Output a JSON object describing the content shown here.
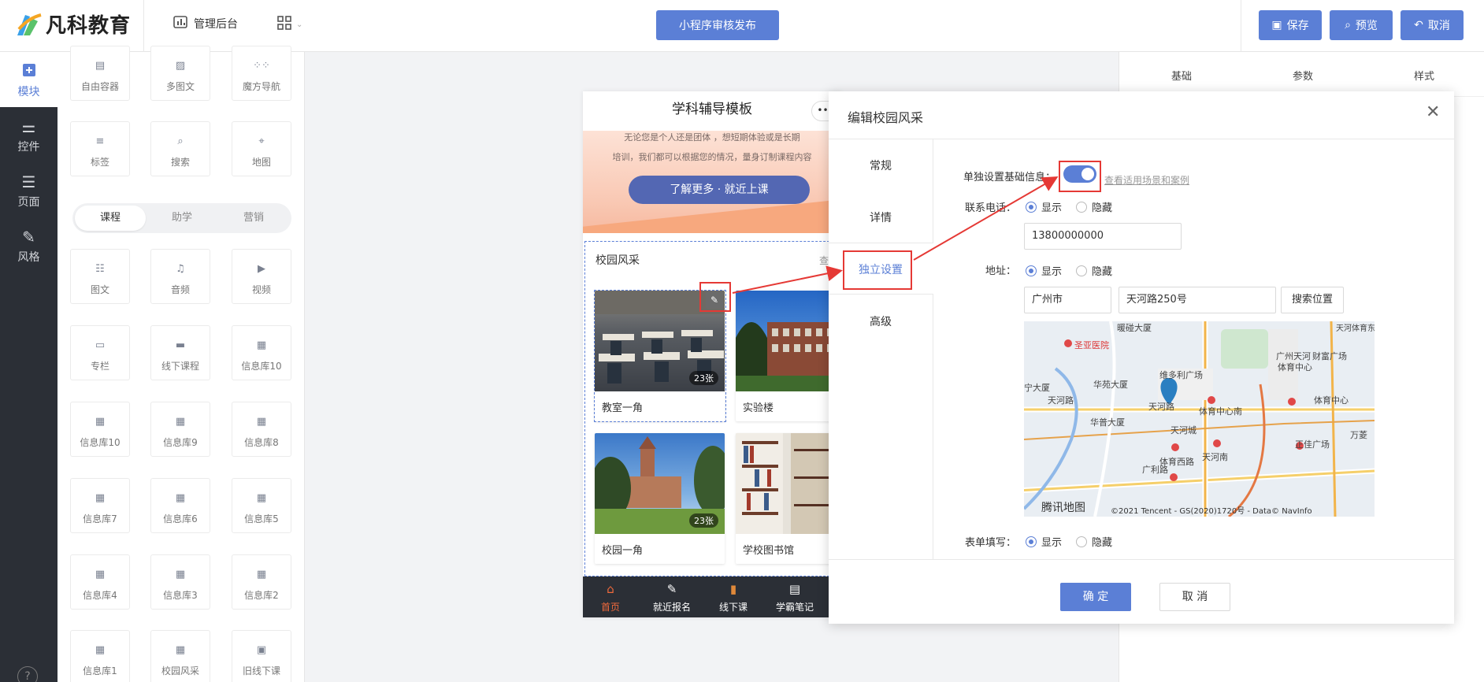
{
  "brand": {
    "name": "凡科教育",
    "accent": "#5b7fd6"
  },
  "topbar": {
    "admin_label": "管理后台",
    "publish_label": "小程序审核发布",
    "save_label": "保存",
    "preview_label": "预览",
    "cancel_label": "取消"
  },
  "leftnav": [
    {
      "label": "模块",
      "icon": "plus-square-icon",
      "active": true
    },
    {
      "label": "控件",
      "icon": "sliders-icon"
    },
    {
      "label": "页面",
      "icon": "layout-icon"
    },
    {
      "label": "风格",
      "icon": "magic-wand-icon"
    }
  ],
  "components": {
    "top": [
      "自由容器",
      "多图文",
      "魔方导航",
      "标签",
      "搜索",
      "地图"
    ],
    "segments": [
      "课程",
      "助学",
      "营销"
    ],
    "items": [
      "图文",
      "音频",
      "视频",
      "专栏",
      "线下课程",
      "信息库10",
      "信息库10",
      "信息库9",
      "信息库8",
      "信息库7",
      "信息库6",
      "信息库5",
      "信息库4",
      "信息库3",
      "信息库2",
      "信息库1",
      "校园风采",
      "旧线下课"
    ]
  },
  "right_panel": {
    "tabs": [
      "基础",
      "参数",
      "样式"
    ]
  },
  "phone": {
    "title": "学科辅导模板",
    "more_icon": "•••",
    "banner_line1": "无论您是个人还是团体 ，想短期体验或是长期",
    "banner_line2": "培训，我们都可以根据您的情况，量身订制课程内容",
    "banner_cta": "了解更多 · 就近上课",
    "campus_title": "校园风采",
    "campus_more": "查",
    "photos": [
      {
        "caption": "教室一角",
        "count": "23张"
      },
      {
        "caption": "实验楼",
        "count": ""
      },
      {
        "caption": "校园一角",
        "count": "23张"
      },
      {
        "caption": "学校图书馆",
        "count": ""
      }
    ],
    "tabbar": [
      {
        "label": "首页",
        "icon": "home-icon",
        "active": true
      },
      {
        "label": "就近报名",
        "icon": "edit-icon"
      },
      {
        "label": "线下课",
        "icon": "book-icon"
      },
      {
        "label": "学霸笔记",
        "icon": "note-icon"
      }
    ]
  },
  "modal": {
    "title": "编辑校园风采",
    "tabs": [
      "常规",
      "详情",
      "独立设置",
      "高级"
    ],
    "active_tab": "独立设置",
    "toggle_label": "单独设置基础信息：",
    "toggle_on": true,
    "help_link": "查看适用场景和案例",
    "phone_label": "联系电话：",
    "show": "显示",
    "hide": "隐藏",
    "phone_value": "13800000000",
    "address_label": "地址：",
    "city_value": "广州市",
    "street_value": "天河路250号",
    "search_pos": "搜索位置",
    "form_label": "表单填写：",
    "ok": "确 定",
    "cancel": "取 消",
    "map": {
      "labels": [
        "暖碰大厦",
        "圣亚医院",
        "华苑大厦",
        "维多利广场",
        "广州天河",
        "体育中心",
        "财富广场",
        "天河路",
        "天河路",
        "华普大厦",
        "体育中心南",
        "体育中心",
        "天河城",
        "正佳广场",
        "万菱",
        "体育西路",
        "天河南",
        "广利路",
        "腾讯地图",
        "宁大厦",
        "天河体育东路"
      ],
      "copyright": "©2021 Tencent - GS(2020)1720号 - Data© NavInfo"
    }
  }
}
